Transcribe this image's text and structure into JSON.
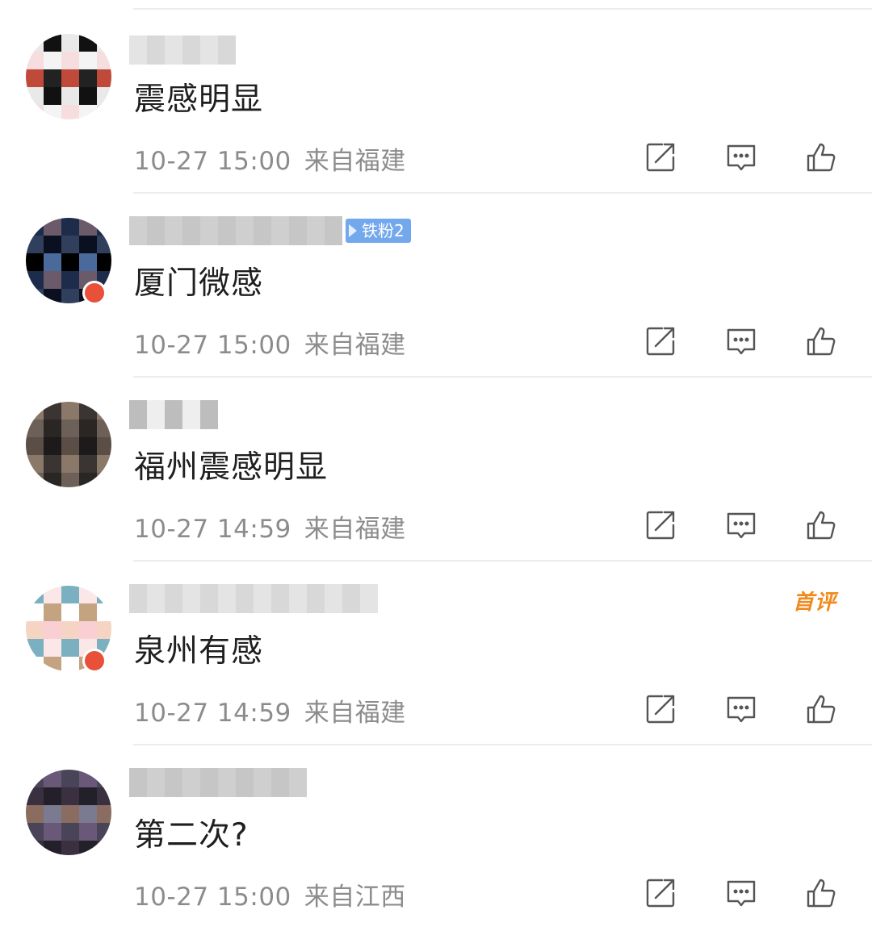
{
  "comments": [
    {
      "content": "震感明显",
      "time": "10-27 15:00",
      "location": "来自福建",
      "fan_badge": "",
      "first_badge": "",
      "avatar_colors": [
        "#e9e9e9",
        "#222222",
        "#f6dede",
        "#111111",
        "#c04a3a",
        "#f4f4f4"
      ]
    },
    {
      "content": "厦门微感",
      "time": "10-27 15:00",
      "location": "来自福建",
      "fan_badge": "铁粉2",
      "first_badge": "",
      "avatar_colors": [
        "#0b1020",
        "#1d2c4a",
        "#4a6a9c",
        "#30405c",
        "#6a5a6a",
        "#000000"
      ]
    },
    {
      "content": "福州震感明显",
      "time": "10-27 14:59",
      "location": "来自福建",
      "fan_badge": "",
      "first_badge": "",
      "avatar_colors": [
        "#5a4e46",
        "#2a2624",
        "#8a7868",
        "#1c1a1a",
        "#6c6058",
        "#3a3432"
      ]
    },
    {
      "content": "泉州有感",
      "time": "10-27 14:59",
      "location": "来自福建",
      "fan_badge": "",
      "first_badge": "首评",
      "avatar_colors": [
        "#fbe6e8",
        "#f6d4c4",
        "#c4a480",
        "#7ab0c0",
        "#f9cfd4",
        "#ffffff"
      ]
    },
    {
      "content": "第二次?",
      "time": "10-27 15:00",
      "location": "来自江西",
      "fan_badge": "",
      "first_badge": "",
      "avatar_colors": [
        "#3a3040",
        "#6a5878",
        "#8a6c60",
        "#24202a",
        "#4a4458",
        "#7a7a90"
      ]
    }
  ],
  "colors": {
    "meta_text": "#8c8c8c",
    "divider": "#ececec",
    "fan_badge_bg": "#73a8ec",
    "first_badge": "#f08a1c",
    "vip_dot": "#e8503a"
  },
  "icons": {
    "share": "share-icon",
    "reply": "comment-icon",
    "like": "thumbs-up-icon"
  }
}
